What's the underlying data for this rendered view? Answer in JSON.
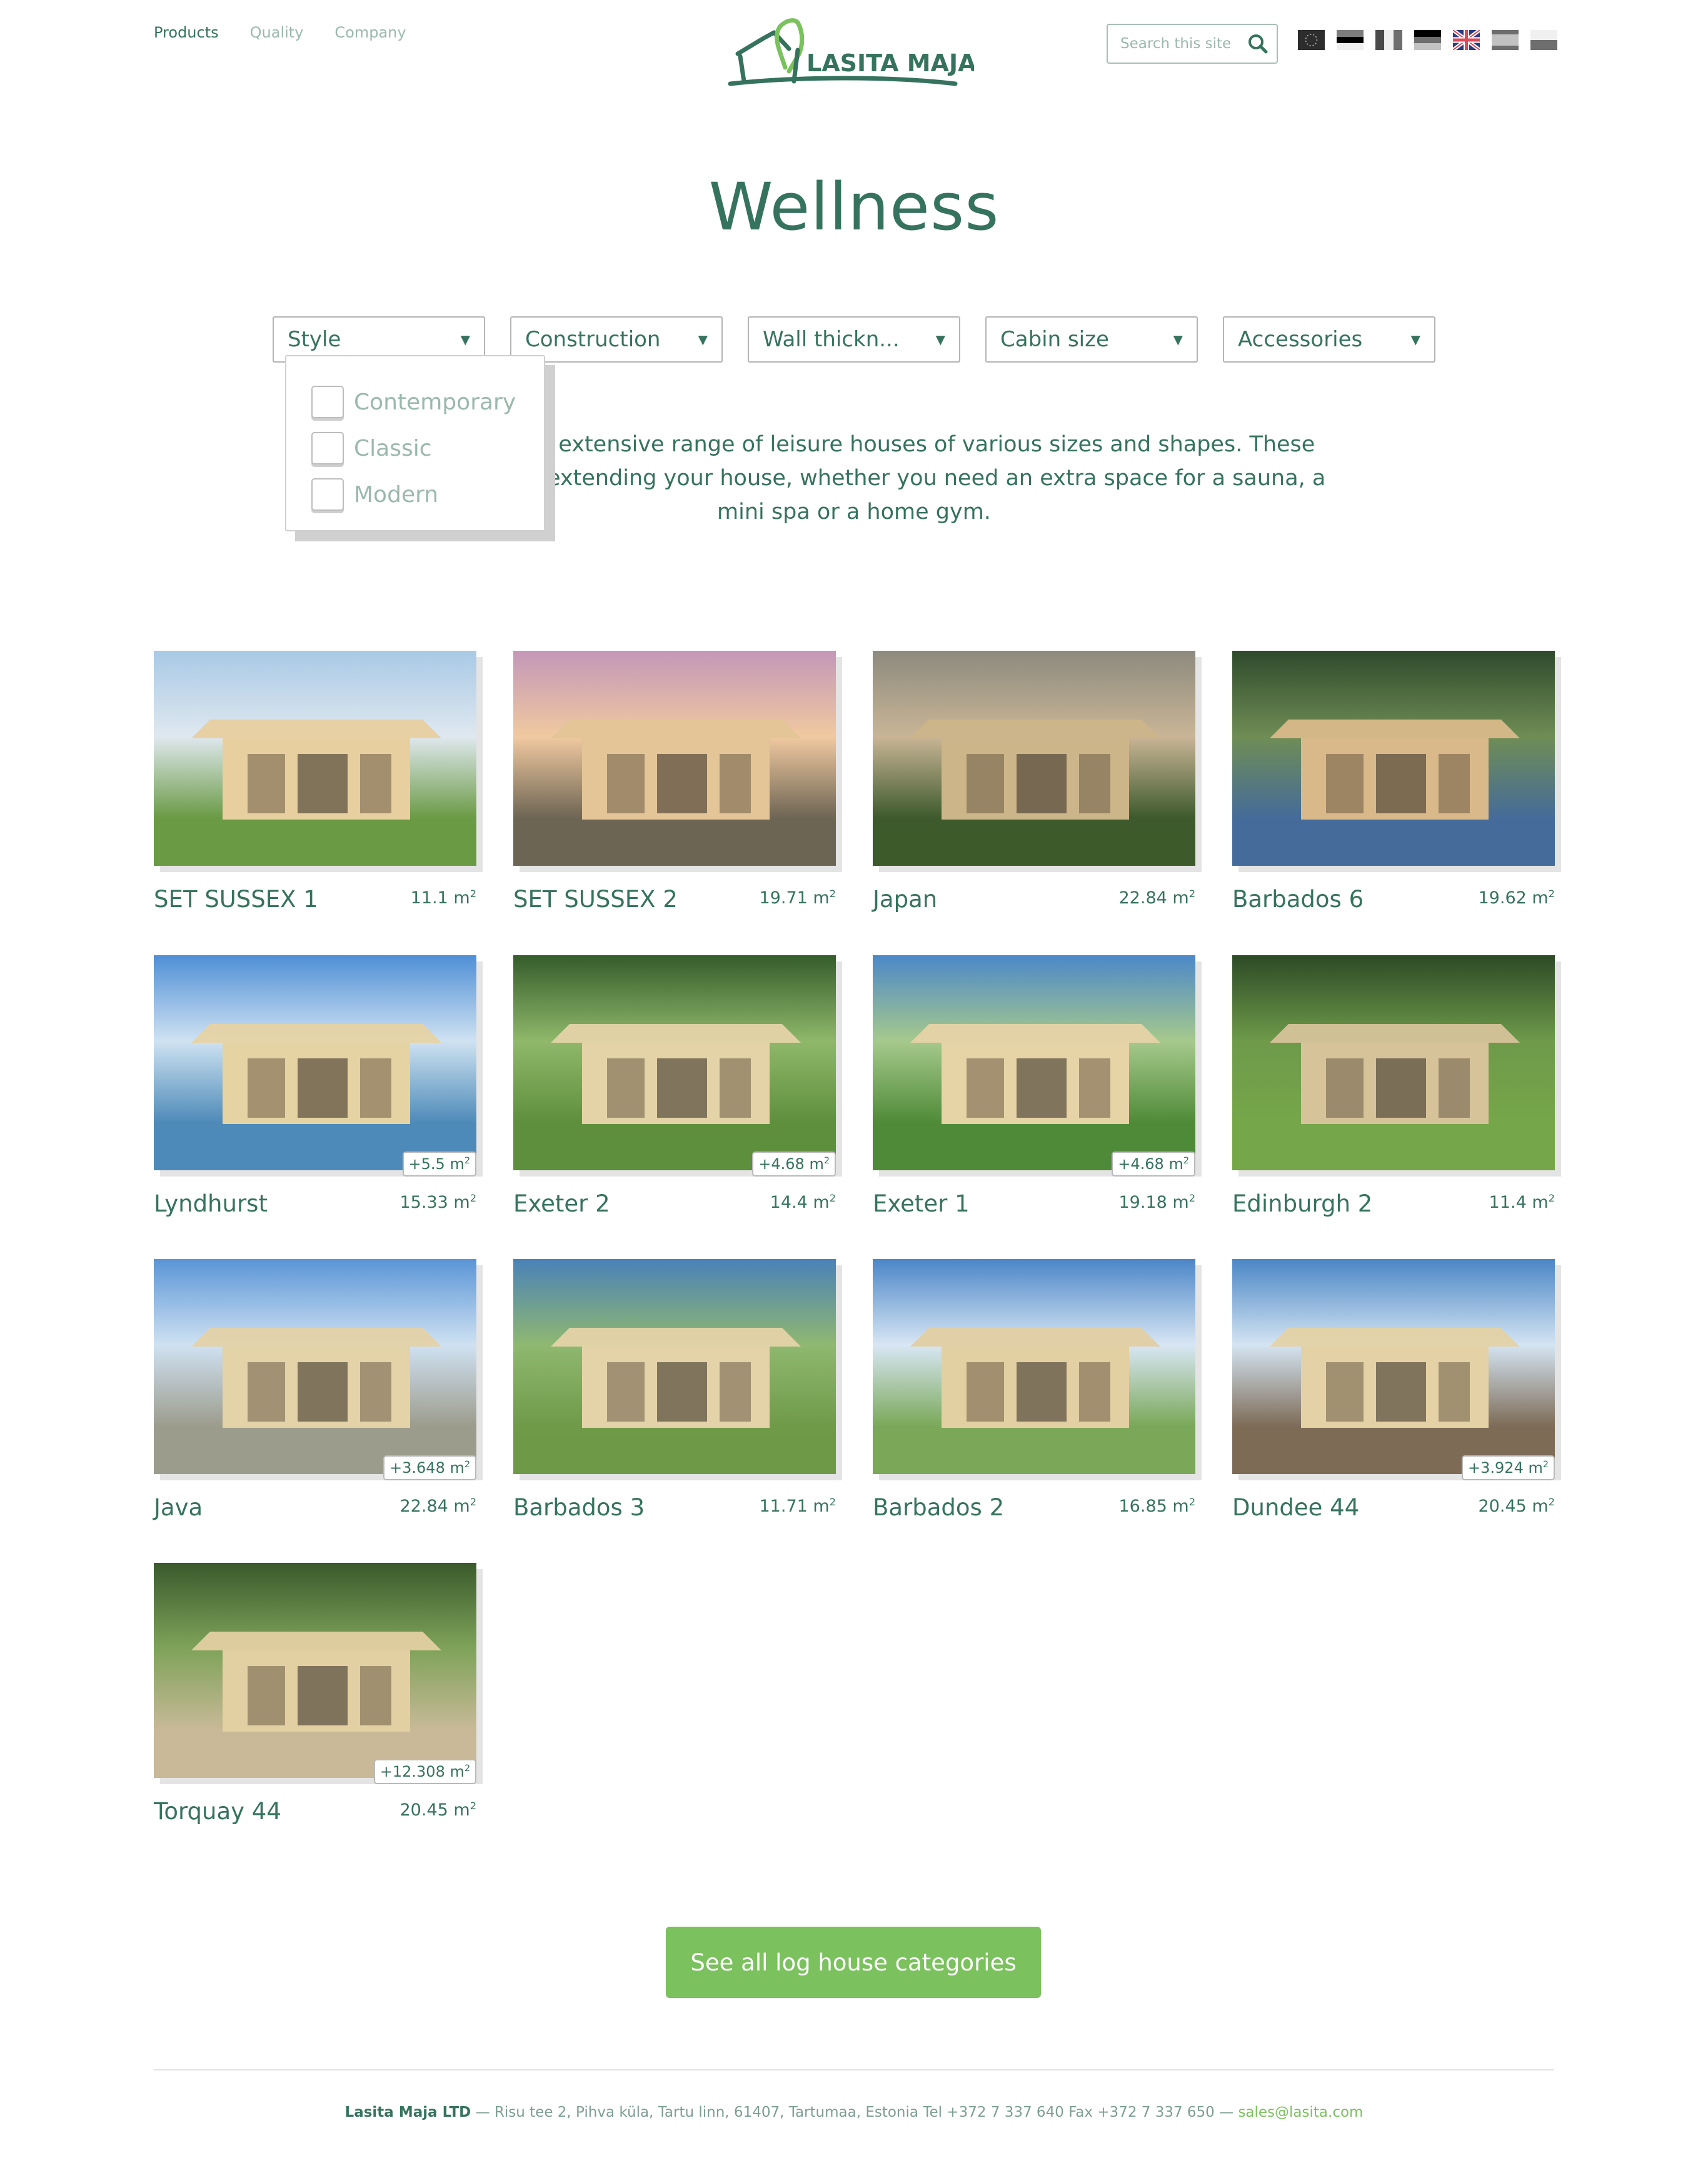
{
  "header": {
    "nav": [
      {
        "label": "Products",
        "active": true
      },
      {
        "label": "Quality",
        "active": false
      },
      {
        "label": "Company",
        "active": false
      }
    ],
    "logo_text": "LASITA MAJA",
    "search": {
      "placeholder": "Search this site",
      "value": ""
    },
    "languages": [
      {
        "code": "eu",
        "label": "EU",
        "active": false
      },
      {
        "code": "ee",
        "label": "Estonian",
        "active": false
      },
      {
        "code": "fr",
        "label": "French",
        "active": false
      },
      {
        "code": "de",
        "label": "German",
        "active": false
      },
      {
        "code": "gb",
        "label": "English",
        "active": true
      },
      {
        "code": "es",
        "label": "Spanish",
        "active": false
      },
      {
        "code": "pl",
        "label": "Polish",
        "active": false
      }
    ]
  },
  "page": {
    "title": "Wellness",
    "description_visible": "nd our extensive range of leisure houses of various sizes and shapes. These ct for extending your house, whether you need an extra space for a sauna, a mini spa or a home gym.",
    "description_lines": [
      "nd our extensive range of leisure houses of various sizes and shapes. These",
      "ct for extending your house, whether you need an extra space for a sauna, a",
      "mini spa or a home gym."
    ]
  },
  "filters": [
    {
      "label": "Style",
      "open": true
    },
    {
      "label": "Construction",
      "open": false
    },
    {
      "label": "Wall thickn...",
      "open": false
    },
    {
      "label": "Cabin size",
      "open": false
    },
    {
      "label": "Accessories",
      "open": false
    }
  ],
  "style_dropdown": {
    "options": [
      {
        "label": "Contemporary",
        "checked": false
      },
      {
        "label": "Classic",
        "checked": false
      },
      {
        "label": "Modern",
        "checked": false
      }
    ]
  },
  "products": [
    {
      "name": "SET SUSSEX 1",
      "area": "11.1 m",
      "extra": null
    },
    {
      "name": "SET SUSSEX 2",
      "area": "19.71 m",
      "extra": null
    },
    {
      "name": "Japan",
      "area": "22.84 m",
      "extra": null
    },
    {
      "name": "Barbados 6",
      "area": "19.62 m",
      "extra": null
    },
    {
      "name": "Lyndhurst",
      "area": "15.33 m",
      "extra": "+5.5 m"
    },
    {
      "name": "Exeter 2",
      "area": "14.4 m",
      "extra": "+4.68 m"
    },
    {
      "name": "Exeter 1",
      "area": "19.18 m",
      "extra": "+4.68 m"
    },
    {
      "name": "Edinburgh 2",
      "area": "11.4 m",
      "extra": null
    },
    {
      "name": "Java",
      "area": "22.84 m",
      "extra": "+3.648 m"
    },
    {
      "name": "Barbados 3",
      "area": "11.71 m",
      "extra": null
    },
    {
      "name": "Barbados 2",
      "area": "16.85 m",
      "extra": null
    },
    {
      "name": "Dundee 44",
      "area": "20.45 m",
      "extra": "+3.924 m"
    },
    {
      "name": "Torquay 44",
      "area": "20.45 m",
      "extra": "+12.308 m"
    }
  ],
  "unit_superscript": "2",
  "cta": {
    "label": "See all log house categories"
  },
  "footer": {
    "company": "Lasita Maja LTD",
    "address": " — Risu tee 2, Pihva küla, Tartu linn, 61407, Tartumaa, Estonia Tel +372 7 337 640 Fax +372 7 337 650 — ",
    "email": "sales@lasita.com"
  },
  "colors": {
    "primary": "#36735e",
    "muted": "#9bb8ad",
    "accent": "#7bc15e"
  }
}
